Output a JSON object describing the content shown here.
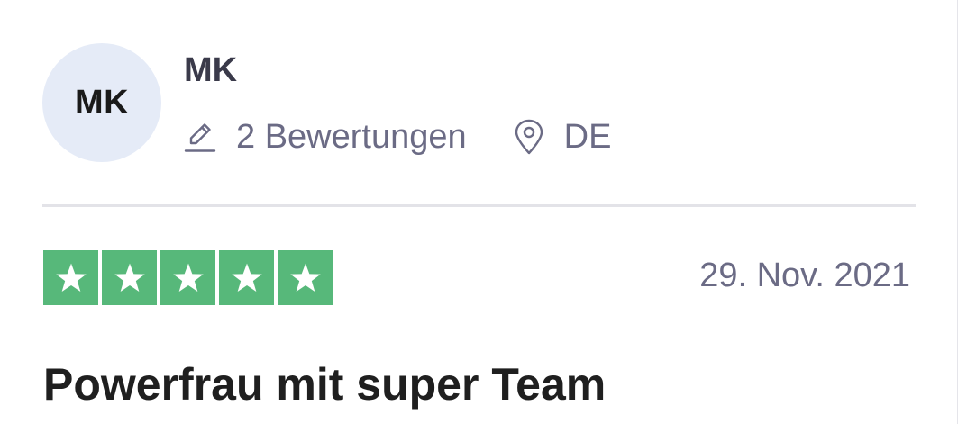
{
  "reviewer": {
    "initials": "MK",
    "name": "MK",
    "reviews_count_text": "2 Bewertungen",
    "country": "DE",
    "avatar_bg_color": "#e5ebf7"
  },
  "icons": {
    "reviews": "pencil-icon",
    "location": "location-pin-icon",
    "star": "star-icon"
  },
  "review": {
    "rating": 5,
    "max_rating": 5,
    "star_color": "#57b87a",
    "date": "29. Nov. 2021",
    "title": "Powerfrau mit super Team"
  }
}
